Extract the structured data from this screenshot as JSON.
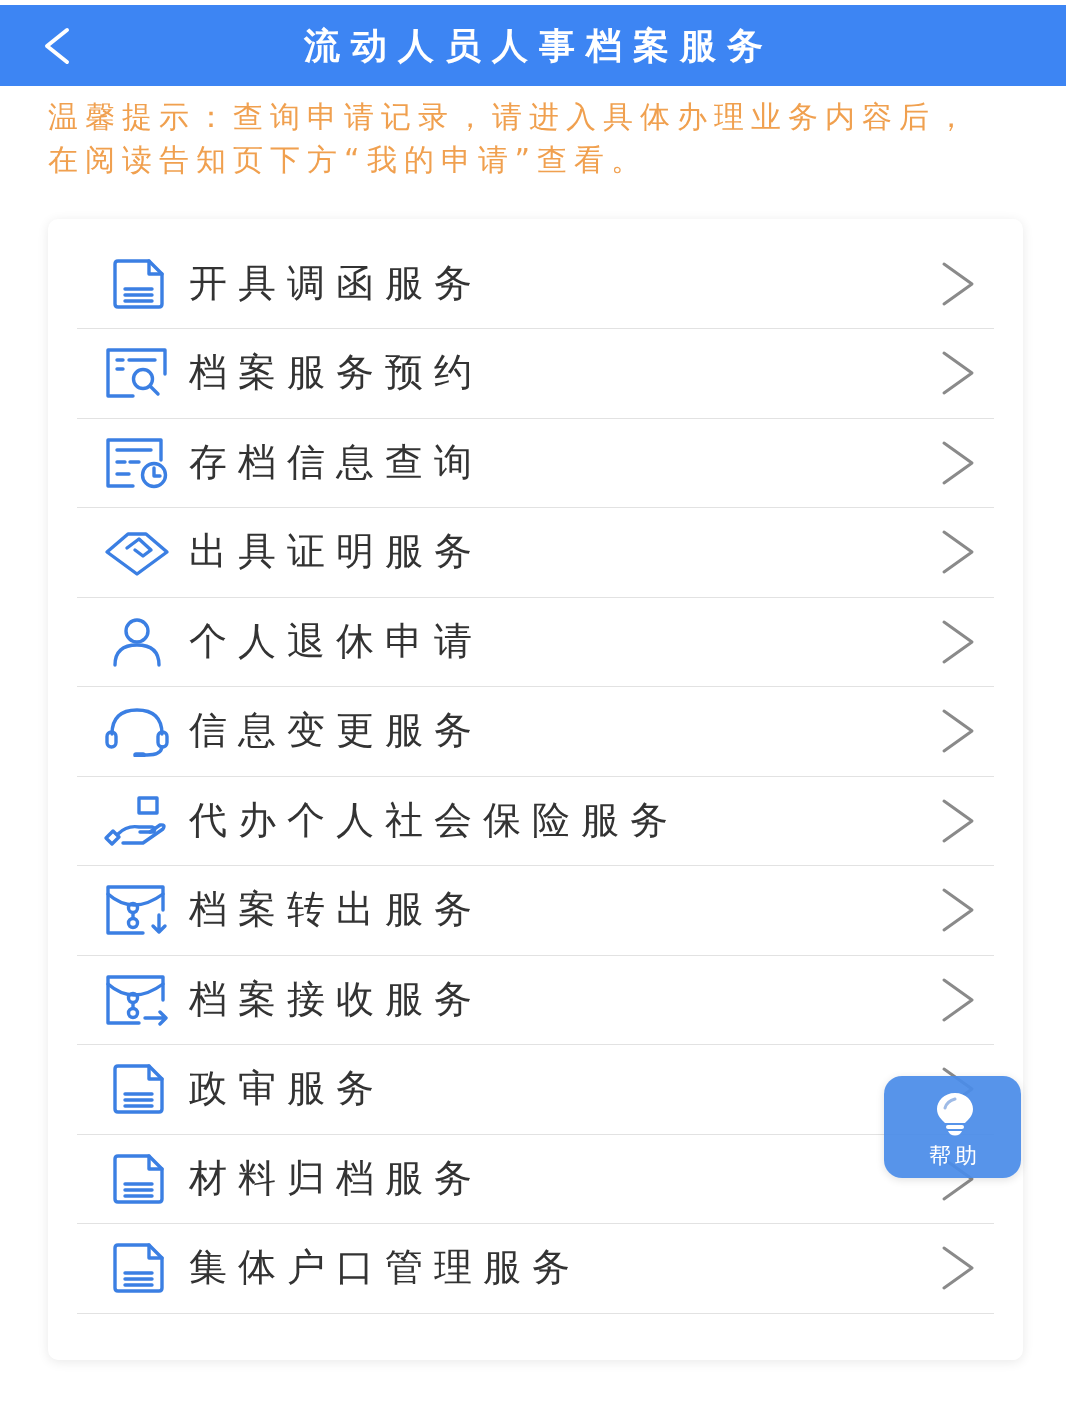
{
  "header": {
    "title": "流动人员人事档案服务"
  },
  "notice": {
    "text": "温馨提示：查询申请记录，请进入具体办理业务内容后，在阅读告知页下方“我的申请”查看。"
  },
  "services": [
    {
      "label": "开具调函服务",
      "kind": "document"
    },
    {
      "label": "档案服务预约",
      "kind": "search-doc"
    },
    {
      "label": "存档信息查询",
      "kind": "clock-doc"
    },
    {
      "label": "出具证明服务",
      "kind": "diamond"
    },
    {
      "label": "个人退休申请",
      "kind": "person"
    },
    {
      "label": "信息变更服务",
      "kind": "headset"
    },
    {
      "label": "代办个人社会保险服务",
      "kind": "hand"
    },
    {
      "label": "档案转出服务",
      "kind": "envelope-down"
    },
    {
      "label": "档案接收服务",
      "kind": "envelope-right"
    },
    {
      "label": "政审服务",
      "kind": "document"
    },
    {
      "label": "材料归档服务",
      "kind": "document"
    },
    {
      "label": "集体户口管理服务",
      "kind": "document"
    }
  ],
  "help_button": {
    "label": "帮助"
  }
}
